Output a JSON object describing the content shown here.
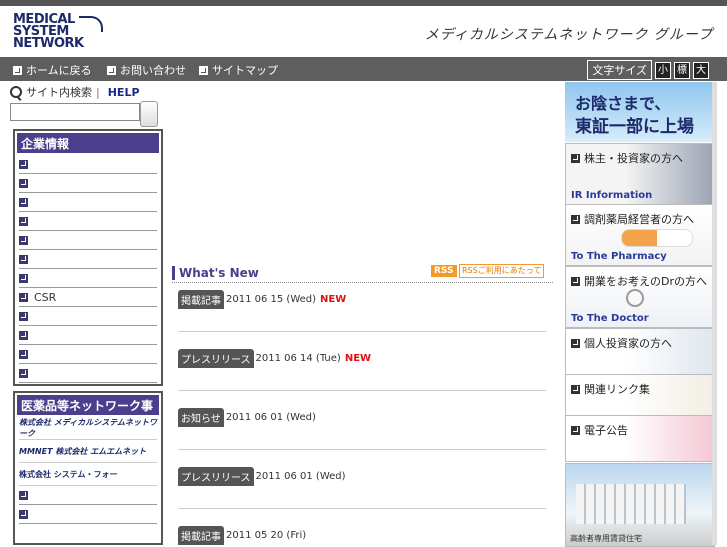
{
  "header": {
    "logo_lines": [
      "MEDICAL",
      "SYSTEM",
      "NETWORK"
    ],
    "group_name": "メディカルシステムネットワーク グループ"
  },
  "nav": {
    "items": [
      "ホームに戻る",
      "お問い合わせ",
      "サイトマップ"
    ],
    "font_size_label": "文字サイズ",
    "font_sizes": [
      "小",
      "標",
      "大"
    ]
  },
  "search": {
    "label": "サイト内検索",
    "help": "HELP",
    "placeholder": ""
  },
  "sidebar": {
    "company_title": "企業情報",
    "company_items": [
      "",
      "",
      "",
      "",
      "",
      "",
      "",
      "CSR",
      "",
      "",
      "",
      ""
    ],
    "network_title": "医薬品等ネットワーク事業",
    "network_logos": [
      "株式会社 メディカルシステムネットワーク",
      "MMNET 株式会社 エムエムネット",
      "株式会社 システム・フォー"
    ],
    "network_items": [
      "",
      ""
    ]
  },
  "main": {
    "whatsnew_title": "What's New",
    "rss_label": "RSS",
    "rss_help": "RSSご利用にあたって",
    "news": [
      {
        "category": "掲載記事",
        "date": "2011 06 15  (Wed)",
        "new": "NEW"
      },
      {
        "category": "プレスリリース",
        "date": "2011 06 14  (Tue)",
        "new": "NEW"
      },
      {
        "category": "お知らせ",
        "date": "2011 06 01  (Wed)",
        "new": ""
      },
      {
        "category": "プレスリリース",
        "date": "2011 06 01  (Wed)",
        "new": ""
      },
      {
        "category": "掲載記事",
        "date": "2011 05 20  (Fri)",
        "new": ""
      }
    ]
  },
  "right": {
    "banner_line1": "お陰さまで、",
    "banner_line2": "東証一部に上場",
    "boxes": [
      {
        "title": "株主・投資家の方へ",
        "sub": "IR Information"
      },
      {
        "title": "調剤薬局経営者の方へ",
        "sub": "To The Pharmacy"
      },
      {
        "title": "開業をお考えのDrの方へ",
        "sub": "To The Doctor"
      },
      {
        "title": "個人投資家の方へ",
        "sub": ""
      },
      {
        "title": "関連リンク集",
        "sub": ""
      },
      {
        "title": "電子公告",
        "sub": ""
      }
    ],
    "bottom_caption": "高齢者専用賃貸住宅"
  }
}
